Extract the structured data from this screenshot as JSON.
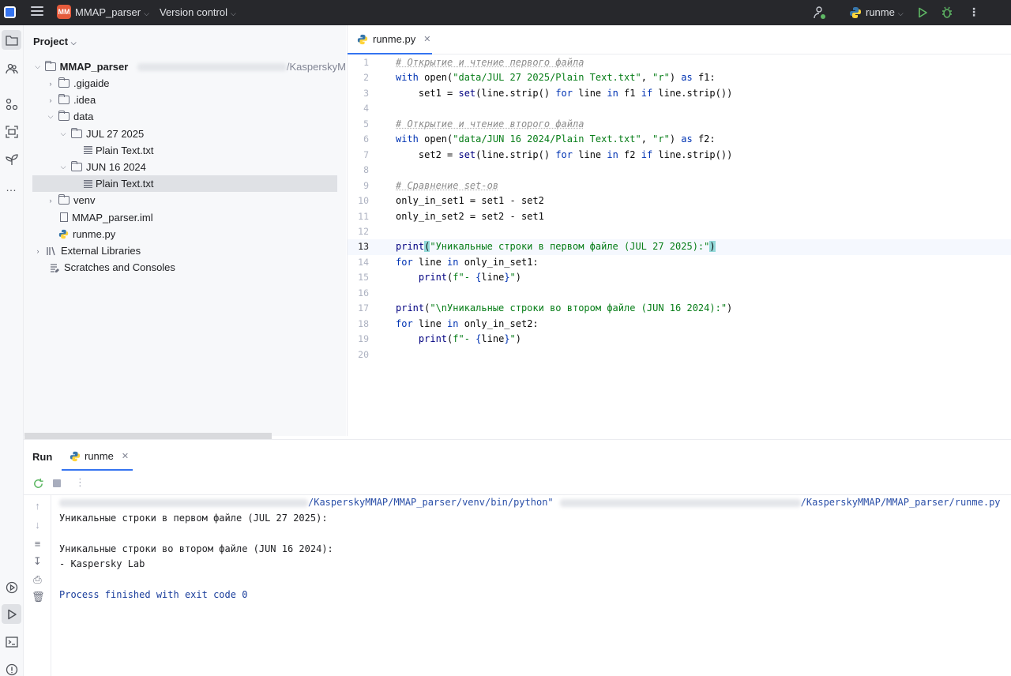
{
  "titlebar": {
    "project_badge": "MM",
    "project_name": "MMAP_parser",
    "version_control": "Version control",
    "run_config": "runme"
  },
  "left_strip": {
    "icons": [
      "project-folder-icon",
      "people-icon",
      "structure-icon",
      "layout-icon",
      "leaf-icon",
      "more-horizontal-icon",
      "services-icon",
      "run-icon",
      "terminal-icon",
      "problems-icon"
    ]
  },
  "project_panel": {
    "title": "Project",
    "root": "MMAP_parser",
    "root_path_tail": "/KasperskyM",
    "items": [
      {
        "label": ".gigaide",
        "type": "folder",
        "level": 1,
        "expanded": false
      },
      {
        "label": ".idea",
        "type": "folder",
        "level": 1,
        "expanded": false
      },
      {
        "label": "data",
        "type": "folder",
        "level": 1,
        "expanded": true
      },
      {
        "label": "JUL 27 2025",
        "type": "folder",
        "level": 2,
        "expanded": true
      },
      {
        "label": "Plain Text.txt",
        "type": "file",
        "level": 3
      },
      {
        "label": "JUN 16 2024",
        "type": "folder",
        "level": 2,
        "expanded": true
      },
      {
        "label": "Plain Text.txt",
        "type": "file",
        "level": 3,
        "selected": true
      },
      {
        "label": "venv",
        "type": "folder",
        "level": 1,
        "expanded": false
      },
      {
        "label": "MMAP_parser.iml",
        "type": "iml",
        "level": 1
      },
      {
        "label": "runme.py",
        "type": "python",
        "level": 1
      }
    ],
    "external_libraries": "External Libraries",
    "scratches": "Scratches and Consoles"
  },
  "editor": {
    "tab_label": "runme.py",
    "current_line": 13,
    "lines": [
      {
        "n": "1",
        "tokens": [
          {
            "t": "# Открытие и чтение первого файла",
            "c": "cmt"
          }
        ]
      },
      {
        "n": "2",
        "tokens": [
          {
            "t": "with",
            "c": "kw"
          },
          {
            "t": " open(",
            "c": ""
          },
          {
            "t": "\"data/JUL 27 2025/Plain Text.txt\"",
            "c": "str"
          },
          {
            "t": ", ",
            "c": ""
          },
          {
            "t": "\"r\"",
            "c": "str"
          },
          {
            "t": ") ",
            "c": ""
          },
          {
            "t": "as",
            "c": "kw"
          },
          {
            "t": " f1:",
            "c": ""
          }
        ]
      },
      {
        "n": "3",
        "tokens": [
          {
            "t": "    set1 = ",
            "c": ""
          },
          {
            "t": "set",
            "c": "fn"
          },
          {
            "t": "(line.strip() ",
            "c": ""
          },
          {
            "t": "for",
            "c": "kw"
          },
          {
            "t": " line ",
            "c": ""
          },
          {
            "t": "in",
            "c": "kw"
          },
          {
            "t": " f1 ",
            "c": ""
          },
          {
            "t": "if",
            "c": "kw"
          },
          {
            "t": " line.strip())",
            "c": ""
          }
        ]
      },
      {
        "n": "4",
        "tokens": []
      },
      {
        "n": "5",
        "tokens": [
          {
            "t": "# Открытие и чтение второго файла",
            "c": "cmt"
          }
        ]
      },
      {
        "n": "6",
        "tokens": [
          {
            "t": "with",
            "c": "kw"
          },
          {
            "t": " open(",
            "c": ""
          },
          {
            "t": "\"data/JUN 16 2024/Plain Text.txt\"",
            "c": "str"
          },
          {
            "t": ", ",
            "c": ""
          },
          {
            "t": "\"r\"",
            "c": "str"
          },
          {
            "t": ") ",
            "c": ""
          },
          {
            "t": "as",
            "c": "kw"
          },
          {
            "t": " f2:",
            "c": ""
          }
        ]
      },
      {
        "n": "7",
        "tokens": [
          {
            "t": "    set2 = ",
            "c": ""
          },
          {
            "t": "set",
            "c": "fn"
          },
          {
            "t": "(line.strip() ",
            "c": ""
          },
          {
            "t": "for",
            "c": "kw"
          },
          {
            "t": " line ",
            "c": ""
          },
          {
            "t": "in",
            "c": "kw"
          },
          {
            "t": " f2 ",
            "c": ""
          },
          {
            "t": "if",
            "c": "kw"
          },
          {
            "t": " line.strip())",
            "c": ""
          }
        ]
      },
      {
        "n": "8",
        "tokens": []
      },
      {
        "n": "9",
        "tokens": [
          {
            "t": "# Сравнение set-ов",
            "c": "cmt"
          }
        ]
      },
      {
        "n": "10",
        "tokens": [
          {
            "t": "only_in_set1 = set1 - set2",
            "c": ""
          }
        ]
      },
      {
        "n": "11",
        "tokens": [
          {
            "t": "only_in_set2 = set2 - set1",
            "c": ""
          }
        ]
      },
      {
        "n": "12",
        "tokens": []
      },
      {
        "n": "13",
        "tokens": [
          {
            "t": "print",
            "c": "fn"
          },
          {
            "t": "(",
            "c": "brace"
          },
          {
            "t": "\"Уникальные строки в первом файле (JUL 27 2025):\"",
            "c": "str"
          },
          {
            "t": ")",
            "c": "brace"
          }
        ]
      },
      {
        "n": "14",
        "tokens": [
          {
            "t": "for",
            "c": "kw"
          },
          {
            "t": " line ",
            "c": ""
          },
          {
            "t": "in",
            "c": "kw"
          },
          {
            "t": " only_in_set1:",
            "c": ""
          }
        ]
      },
      {
        "n": "15",
        "tokens": [
          {
            "t": "    ",
            "c": ""
          },
          {
            "t": "print",
            "c": "fn"
          },
          {
            "t": "(",
            "c": ""
          },
          {
            "t": "f\"- ",
            "c": "str"
          },
          {
            "t": "{",
            "c": "kw"
          },
          {
            "t": "line",
            "c": ""
          },
          {
            "t": "}",
            "c": "kw"
          },
          {
            "t": "\"",
            "c": "str"
          },
          {
            "t": ")",
            "c": ""
          }
        ]
      },
      {
        "n": "16",
        "tokens": []
      },
      {
        "n": "17",
        "tokens": [
          {
            "t": "print",
            "c": "fn"
          },
          {
            "t": "(",
            "c": ""
          },
          {
            "t": "\"\\nУникальные строки во втором файле (JUN 16 2024):\"",
            "c": "str"
          },
          {
            "t": ")",
            "c": ""
          }
        ]
      },
      {
        "n": "18",
        "tokens": [
          {
            "t": "for",
            "c": "kw"
          },
          {
            "t": " line ",
            "c": ""
          },
          {
            "t": "in",
            "c": "kw"
          },
          {
            "t": " only_in_set2:",
            "c": ""
          }
        ]
      },
      {
        "n": "19",
        "tokens": [
          {
            "t": "    ",
            "c": ""
          },
          {
            "t": "print",
            "c": "fn"
          },
          {
            "t": "(",
            "c": ""
          },
          {
            "t": "f\"- ",
            "c": "str"
          },
          {
            "t": "{",
            "c": "kw"
          },
          {
            "t": "line",
            "c": ""
          },
          {
            "t": "}",
            "c": "kw"
          },
          {
            "t": "\"",
            "c": "str"
          },
          {
            "t": ")",
            "c": ""
          }
        ]
      },
      {
        "n": "20",
        "tokens": []
      }
    ]
  },
  "run_panel": {
    "title": "Run",
    "tab_label": "runme",
    "command_part1": "/KasperskyMMAP/MMAP_parser/venv/bin/python\"",
    "command_part2": "/KasperskyMMAP/MMAP_parser/runme.py",
    "output": [
      "Уникальные строки в первом файле (JUL 27 2025):",
      "",
      "Уникальные строки во втором файле (JUN 16 2024):",
      "- Kaspersky Lab",
      "",
      "Process finished with exit code 0"
    ]
  },
  "colors": {
    "accent": "#3574f0",
    "keyword": "#0033b3",
    "string": "#067d17",
    "comment": "#8c8c8c",
    "titlebar_bg": "#27282c"
  }
}
